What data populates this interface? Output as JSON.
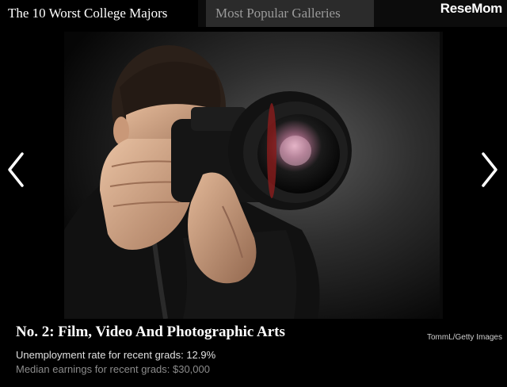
{
  "tabs": [
    {
      "label": "The 10 Worst College Majors",
      "active": true
    },
    {
      "label": "Most Popular Galleries",
      "active": false
    }
  ],
  "brand": {
    "logo_text": "ReseMom"
  },
  "slide": {
    "photo_description_icon": "photographer-with-camera-photo",
    "credit": "TommL/Getty Images",
    "title": "No. 2: Film, Video And Photographic Arts",
    "stats": [
      "Unemployment rate for recent grads: 12.9%",
      "Median earnings for recent grads: $30,000"
    ]
  },
  "navigation": {
    "prev_icon": "chevron-left-icon",
    "next_icon": "chevron-right-icon"
  },
  "colors": {
    "background": "#000000",
    "tab_active_bg": "#000000",
    "tab_inactive_bg": "#2b2b2b",
    "tab_inactive_text": "#9a9a9a",
    "title_text": "#ffffff",
    "stat_secondary_text": "#8c8c8c"
  }
}
